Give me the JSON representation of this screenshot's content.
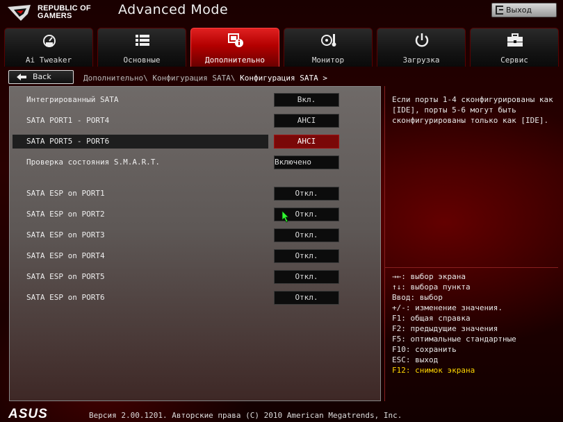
{
  "header": {
    "brand_line1": "REPUBLIC OF",
    "brand_line2": "GAMERS",
    "mode_title": "Advanced Mode",
    "exit_label": "Выход"
  },
  "tabs": [
    {
      "label": "Ai Tweaker",
      "icon": "speedometer-icon",
      "active": false
    },
    {
      "label": "Основные",
      "icon": "list-icon",
      "active": false
    },
    {
      "label": "Дополнительно",
      "icon": "advanced-chip-icon",
      "active": true
    },
    {
      "label": "Монитор",
      "icon": "fan-temperature-icon",
      "active": false
    },
    {
      "label": "Загрузка",
      "icon": "power-icon",
      "active": false
    },
    {
      "label": "Сервис",
      "icon": "toolbox-icon",
      "active": false
    }
  ],
  "nav": {
    "back_label": "Back",
    "breadcrumb_path": "Дополнительно\\ Конфигурация SATA\\ ",
    "breadcrumb_current": "Конфигурация SATA >"
  },
  "settings": [
    {
      "label": "Интегрированный SATA",
      "value": "Вкл."
    },
    {
      "label": "SATA PORT1 - PORT4",
      "value": "AHCI"
    },
    {
      "label": "SATA PORT5 - PORT6",
      "value": "AHCI",
      "selected": true
    },
    {
      "label": "Проверка состояния S.M.A.R.T.",
      "value": "Включено"
    },
    {
      "label": "SATA ESP on PORT1",
      "value": "Откл."
    },
    {
      "label": "SATA ESP on PORT2",
      "value": "Откл."
    },
    {
      "label": "SATA ESP on PORT3",
      "value": "Откл."
    },
    {
      "label": "SATA ESP on PORT4",
      "value": "Откл."
    },
    {
      "label": "SATA ESP on PORT5",
      "value": "Откл."
    },
    {
      "label": "SATA ESP on PORT6",
      "value": "Откл."
    }
  ],
  "help": {
    "text": "Если порты 1-4 сконфигурированы как [IDE], порты 5-6 могут быть сконфигурированы только как [IDE]."
  },
  "keys": [
    "→←: выбор экрана",
    "↑↓: выбора пункта",
    "Ввод: выбор",
    "+/-: изменение значения.",
    "F1: общая справка",
    "F2: предыдущие значения",
    "F5: оптимальные стандартные",
    "F10: сохранить",
    "ESC: выход",
    "F12: снимок экрана"
  ],
  "footer": {
    "brand": "ASUS",
    "version": "Версия 2.00.1201. Авторские права (C) 2010 American Megatrends, Inc."
  },
  "colors": {
    "accent_red": "#c00000",
    "selected_value_bg": "#7a0808",
    "highlight_key": "#ffd700"
  }
}
